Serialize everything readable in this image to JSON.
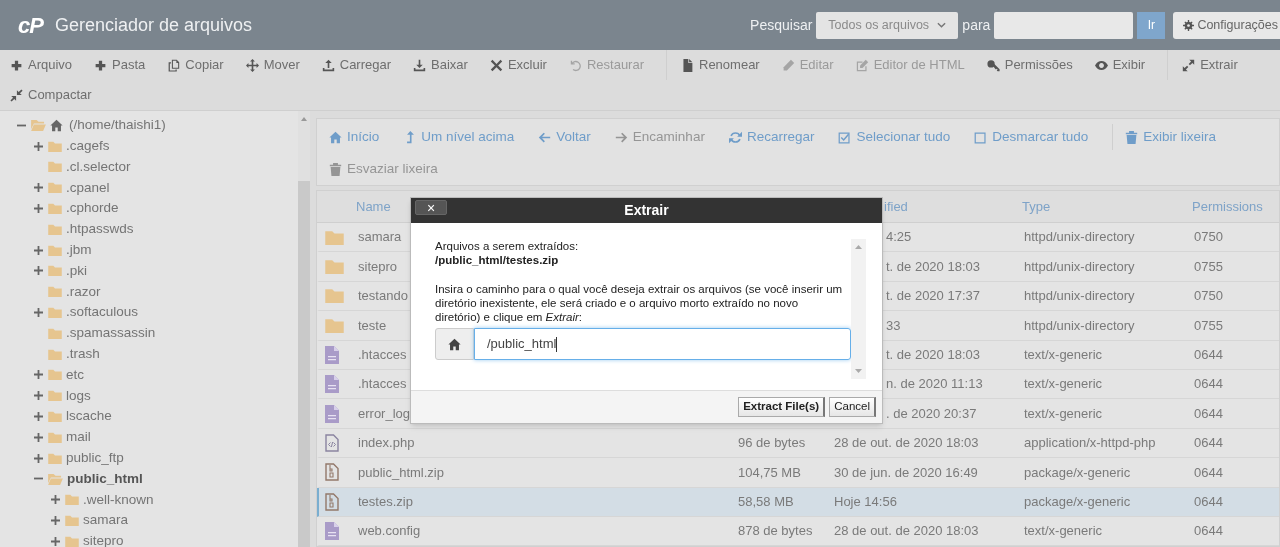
{
  "header": {
    "logo": "cP",
    "title": "Gerenciador de arquivos",
    "search_label": "Pesquisar",
    "scope": "Todos os arquivos",
    "for_label": "para",
    "go": "Ir",
    "settings": "Configurações"
  },
  "toolbar": [
    {
      "label": "Arquivo",
      "disabled": false,
      "separator_before": false
    },
    {
      "label": "Pasta",
      "disabled": false,
      "separator_before": false
    },
    {
      "label": "Copiar",
      "disabled": false,
      "separator_before": false
    },
    {
      "label": "Mover",
      "disabled": false,
      "separator_before": false
    },
    {
      "label": "Carregar",
      "disabled": false,
      "separator_before": false
    },
    {
      "label": "Baixar",
      "disabled": false,
      "separator_before": false
    },
    {
      "label": "Excluir",
      "disabled": false,
      "separator_before": false
    },
    {
      "label": "Restaurar",
      "disabled": true,
      "separator_before": false
    },
    {
      "label": "Renomear",
      "disabled": false,
      "separator_before": true
    },
    {
      "label": "Editar",
      "disabled": true,
      "separator_before": false
    },
    {
      "label": "Editor de HTML",
      "disabled": true,
      "separator_before": false
    },
    {
      "label": "Permissões",
      "disabled": false,
      "separator_before": false
    },
    {
      "label": "Exibir",
      "disabled": false,
      "separator_before": false
    },
    {
      "label": "Extrair",
      "disabled": false,
      "separator_before": true
    },
    {
      "label": "Compactar",
      "disabled": false,
      "separator_before": false
    }
  ],
  "tree": {
    "label": "(/home/thaishi1)",
    "expanded": true,
    "children": [
      {
        "label": ".cagefs",
        "expandable": true,
        "expanded": false,
        "selected": false
      },
      {
        "label": ".cl.selector",
        "expandable": false,
        "expanded": false,
        "selected": false
      },
      {
        "label": ".cpanel",
        "expandable": true,
        "expanded": false,
        "selected": false
      },
      {
        "label": ".cphorde",
        "expandable": true,
        "expanded": false,
        "selected": false
      },
      {
        "label": ".htpasswds",
        "expandable": false,
        "expanded": false,
        "selected": false
      },
      {
        "label": ".jbm",
        "expandable": true,
        "expanded": false,
        "selected": false
      },
      {
        "label": ".pki",
        "expandable": true,
        "expanded": false,
        "selected": false
      },
      {
        "label": ".razor",
        "expandable": false,
        "expanded": false,
        "selected": false
      },
      {
        "label": ".softaculous",
        "expandable": true,
        "expanded": false,
        "selected": false
      },
      {
        "label": ".spamassassin",
        "expandable": false,
        "expanded": false,
        "selected": false
      },
      {
        "label": ".trash",
        "expandable": false,
        "expanded": false,
        "selected": false
      },
      {
        "label": "etc",
        "expandable": true,
        "expanded": false,
        "selected": false
      },
      {
        "label": "logs",
        "expandable": true,
        "expanded": false,
        "selected": false
      },
      {
        "label": "lscache",
        "expandable": true,
        "expanded": false,
        "selected": false
      },
      {
        "label": "mail",
        "expandable": true,
        "expanded": false,
        "selected": false
      },
      {
        "label": "public_ftp",
        "expandable": true,
        "expanded": false,
        "selected": false
      },
      {
        "label": "public_html",
        "expandable": true,
        "expanded": true,
        "selected": true,
        "children": [
          {
            "label": ".well-known",
            "expandable": true,
            "expanded": false,
            "selected": false
          },
          {
            "label": "samara",
            "expandable": true,
            "expanded": false,
            "selected": false
          },
          {
            "label": "sitepro",
            "expandable": true,
            "expanded": false,
            "selected": false
          }
        ]
      }
    ]
  },
  "nav": [
    {
      "label": "Início",
      "disabled": false,
      "separator_before": false
    },
    {
      "label": "Um nível acima",
      "disabled": false,
      "separator_before": false
    },
    {
      "label": "Voltar",
      "disabled": false,
      "separator_before": false
    },
    {
      "label": "Encaminhar",
      "disabled": true,
      "separator_before": false
    },
    {
      "label": "Recarregar",
      "disabled": false,
      "separator_before": false
    },
    {
      "label": "Selecionar tudo",
      "disabled": false,
      "separator_before": false
    },
    {
      "label": "Desmarcar tudo",
      "disabled": false,
      "separator_before": false
    },
    {
      "label": "Exibir lixeira",
      "disabled": false,
      "separator_before": true
    },
    {
      "label": "Esvaziar lixeira",
      "disabled": true,
      "separator_before": false
    }
  ],
  "table": {
    "header": {
      "name": "Name",
      "modified": "ified",
      "type": "Type",
      "permissions": "Permissions"
    },
    "rows": [
      {
        "kind": "folder",
        "name": "samara",
        "modified": "4:25",
        "type": "httpd/unix-directory",
        "permissions": "0750",
        "selected": false,
        "partly_covered": true
      },
      {
        "kind": "folder",
        "name": "sitepro",
        "modified": "t. de 2020 18:03",
        "type": "httpd/unix-directory",
        "permissions": "0755",
        "selected": false,
        "partly_covered": true
      },
      {
        "kind": "folder",
        "name": "testando",
        "modified": "t. de 2020 17:37",
        "type": "httpd/unix-directory",
        "permissions": "0750",
        "selected": false,
        "partly_covered": true
      },
      {
        "kind": "folder",
        "name": "teste",
        "modified": "33",
        "type": "httpd/unix-directory",
        "permissions": "0755",
        "selected": false,
        "partly_covered": true
      },
      {
        "kind": "text",
        "name": ".htacces",
        "modified": "t. de 2020 18:03",
        "type": "text/x-generic",
        "permissions": "0644",
        "selected": false,
        "partly_covered": true
      },
      {
        "kind": "text",
        "name": ".htacces",
        "modified": "n. de 2020 11:13",
        "type": "text/x-generic",
        "permissions": "0644",
        "selected": false,
        "partly_covered": true
      },
      {
        "kind": "text",
        "name": "error_log",
        "modified": ". de 2020 20:37",
        "type": "text/x-generic",
        "permissions": "0644",
        "selected": false,
        "partly_covered": true
      },
      {
        "kind": "code",
        "name": "index.php",
        "size": "96 de bytes",
        "modified": "28 de out. de 2020 18:03",
        "type": "application/x-httpd-php",
        "permissions": "0644",
        "selected": false,
        "partly_covered": false
      },
      {
        "kind": "archive",
        "name": "public_html.zip",
        "size": "104,75 MB",
        "modified": "30 de jun. de 2020 16:49",
        "type": "package/x-generic",
        "permissions": "0644",
        "selected": false,
        "partly_covered": false
      },
      {
        "kind": "archive",
        "name": "testes.zip",
        "size": "58,58 MB",
        "modified": "Hoje 14:56",
        "type": "package/x-generic",
        "permissions": "0644",
        "selected": true,
        "partly_covered": false
      },
      {
        "kind": "text",
        "name": "web.config",
        "size": "878 de bytes",
        "modified": "28 de out. de 2020 18:03",
        "type": "text/x-generic",
        "permissions": "0644",
        "selected": false,
        "partly_covered": false
      }
    ]
  },
  "dialog": {
    "title": "Extrair",
    "close": "×",
    "files_label": "Arquivos a serem extraídos:",
    "files": "/public_html/testes.zip",
    "instruction": "Insira o caminho para o qual você deseja extrair os arquivos (se você inserir um diretório inexistente, ele será criado e o arquivo morto extraído no novo diretório) e clique em *Extrair*:",
    "path": "/public_html",
    "buttons": [
      "Extract File(s)",
      "Cancel"
    ]
  }
}
